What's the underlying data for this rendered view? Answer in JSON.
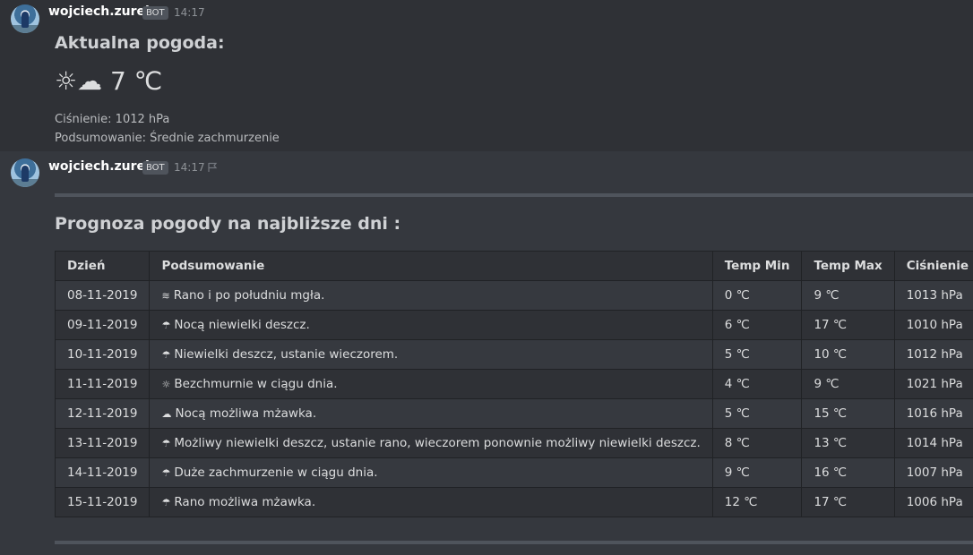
{
  "message1": {
    "author": "wojciech.zurek",
    "badge": "BOT",
    "time": "14:17",
    "title": "Aktualna pogoda:",
    "current": "☼☁ 7 ℃",
    "pressure_line": "Ciśnienie: 1012 hPa",
    "summary_line": "Podsumowanie: Średnie zachmurzenie"
  },
  "message2": {
    "author": "wojciech.zurek",
    "badge": "BOT",
    "time": "14:17",
    "title": "Prognoza pogody na najbliższe dni :",
    "table": {
      "headers": [
        "Dzień",
        "Podsumowanie",
        "Temp Min",
        "Temp Max",
        "Ciśnienie"
      ],
      "rows": [
        {
          "day": "08-11-2019",
          "icon": "≋",
          "icon_name": "fog-icon",
          "summary": "Rano i po południu mgła.",
          "min": "0 ℃",
          "max": "9 ℃",
          "pressure": "1013 hPa"
        },
        {
          "day": "09-11-2019",
          "icon": "☂",
          "icon_name": "umbrella-icon",
          "summary": "Nocą niewielki deszcz.",
          "min": "6 ℃",
          "max": "17 ℃",
          "pressure": "1010 hPa"
        },
        {
          "day": "10-11-2019",
          "icon": "☂",
          "icon_name": "umbrella-icon",
          "summary": "Niewielki deszcz, ustanie wieczorem.",
          "min": "5 ℃",
          "max": "10 ℃",
          "pressure": "1012 hPa"
        },
        {
          "day": "11-11-2019",
          "icon": "☼",
          "icon_name": "sun-icon",
          "summary": "Bezchmurnie w ciągu dnia.",
          "min": "4 ℃",
          "max": "9 ℃",
          "pressure": "1021 hPa"
        },
        {
          "day": "12-11-2019",
          "icon": "☁",
          "icon_name": "cloud-icon",
          "summary": "Nocą możliwa mżawka.",
          "min": "5 ℃",
          "max": "15 ℃",
          "pressure": "1016 hPa"
        },
        {
          "day": "13-11-2019",
          "icon": "☂",
          "icon_name": "umbrella-icon",
          "summary": "Możliwy niewielki deszcz, ustanie rano, wieczorem ponownie możliwy niewielki deszcz.",
          "min": "8 ℃",
          "max": "13 ℃",
          "pressure": "1014 hPa"
        },
        {
          "day": "14-11-2019",
          "icon": "☂",
          "icon_name": "umbrella-icon",
          "summary": "Duże zachmurzenie w ciągu dnia.",
          "min": "9 ℃",
          "max": "16 ℃",
          "pressure": "1007 hPa"
        },
        {
          "day": "15-11-2019",
          "icon": "☂",
          "icon_name": "umbrella-icon",
          "summary": "Rano możliwa mżawka.",
          "min": "12 ℃",
          "max": "17 ℃",
          "pressure": "1006 hPa"
        }
      ]
    }
  }
}
